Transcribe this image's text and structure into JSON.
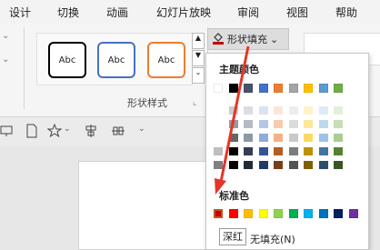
{
  "ribbon_tabs": [
    "设计",
    "切换",
    "动画",
    "幻灯片放映",
    "审阅",
    "视图",
    "帮助"
  ],
  "shape_styles": {
    "sample_text": "Abc",
    "group_label": "形状样式",
    "colors": [
      "#000000",
      "#4472c4",
      "#ed7d31"
    ]
  },
  "fill_button": {
    "label": "形状填充",
    "chevron": "⌄"
  },
  "menu": {
    "theme_colors_label": "主题颜色",
    "standard_colors_label": "标准色",
    "theme_colors": [
      "#ffffff",
      "#000000",
      "#44546a",
      "#4472c4",
      "#ed7d31",
      "#a5a5a5",
      "#ffc000",
      "#5b9bd5",
      "#70ad47"
    ],
    "standard_colors": [
      "#c00000",
      "#ff0000",
      "#ffc000",
      "#ffff00",
      "#92d050",
      "#00b050",
      "#00b0f0",
      "#0070c0",
      "#002060",
      "#7030a0"
    ],
    "tooltip": "深红",
    "no_fill_label": "无填充(N)"
  },
  "colors": {
    "arrow": "#e53529",
    "selected_border": "#c8511b"
  },
  "icons": [
    "paint-bucket-icon",
    "slideshow-icon",
    "document-icon",
    "star-icon",
    "align-icon",
    "distribute-icon",
    "chevron-down-icon"
  ]
}
